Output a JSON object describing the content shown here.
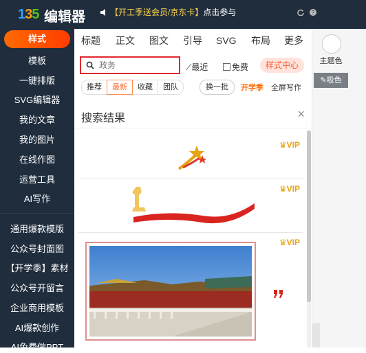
{
  "header": {
    "logo_mark": [
      "1",
      "3",
      "5"
    ],
    "app_name": "编辑器",
    "promo_prefix": "【开工季送会员/京东卡】",
    "promo_suffix": "点击参与"
  },
  "sidebar": {
    "items": [
      {
        "label": "样式",
        "active": true
      },
      {
        "label": "模板"
      },
      {
        "label": "一键排版"
      },
      {
        "label": "SVG编辑器"
      },
      {
        "label": "我的文章"
      },
      {
        "label": "我的图片"
      },
      {
        "label": "在线作图"
      },
      {
        "label": "运营工具"
      },
      {
        "label": "AI写作"
      },
      {
        "label": "通用爆款模版"
      },
      {
        "label": "公众号封面图"
      },
      {
        "label": "【开学季】素材"
      },
      {
        "label": "公众号开留言"
      },
      {
        "label": "企业商用模板"
      },
      {
        "label": "AI爆款创作"
      },
      {
        "label": "AI免费做PPT"
      }
    ]
  },
  "tabs": [
    "标题",
    "正文",
    "图文",
    "引导",
    "SVG",
    "布局",
    "更多"
  ],
  "search": {
    "placeholder": "政务",
    "recent_label": "最近",
    "free_label": "免费",
    "style_center_label": "样式中心"
  },
  "filters": {
    "segments": [
      "推荐",
      "最新",
      "收藏",
      "团队"
    ],
    "active_segment": "最新",
    "refresh_label": "换一批",
    "season_label": "开学季",
    "fullscreen_label": "全屏写作"
  },
  "results": {
    "title": "搜索结果",
    "close_label": "×",
    "vip_label": "VIP"
  },
  "right": {
    "theme_label": "主题色",
    "pick_label": "吸色"
  },
  "colors": {
    "accent": "#ff5a1f",
    "sidebar_bg": "#1f2d3d",
    "vip": "#e8a314",
    "highlight_box": "#e0282f"
  }
}
